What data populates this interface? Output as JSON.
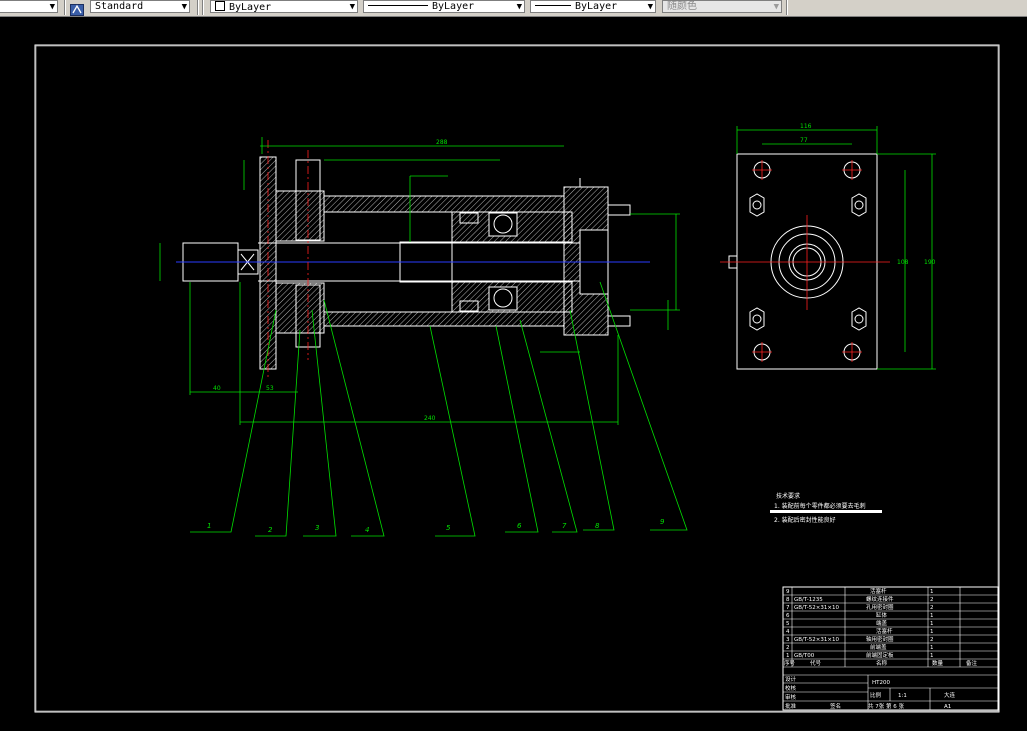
{
  "toolbar": {
    "first_combo_arrow": "▼",
    "text_style": "Standard",
    "layer": "ByLayer",
    "linetype": "ByLayer",
    "lineweight": "ByLayer",
    "plot_style": "随颜色"
  },
  "drawing": {
    "balloons": [
      "1",
      "2",
      "3",
      "4",
      "5",
      "6",
      "7",
      "8",
      "9"
    ],
    "tech_req_title": "技术要求",
    "tech_req_1": "1. 装配前每个零件都必须要去毛刺",
    "tech_req_2": "2. 装配后密封性能良好",
    "bom_rows": [
      {
        "no": "9",
        "code": "",
        "name": "活塞杆",
        "qty": "1"
      },
      {
        "no": "8",
        "code": "GB/T-1235",
        "name": "螺纹连接件",
        "qty": "2"
      },
      {
        "no": "7",
        "code": "GB/T-52×31×10",
        "name": "孔用密封圈",
        "qty": "2"
      },
      {
        "no": "6",
        "code": "",
        "name": "缸体",
        "qty": "1"
      },
      {
        "no": "5",
        "code": "",
        "name": "端盖",
        "qty": "1"
      },
      {
        "no": "4",
        "code": "",
        "name": "活塞杆",
        "qty": "1"
      },
      {
        "no": "3",
        "code": "GB/T-52×31×10",
        "name": "轴用密封圈",
        "qty": "2"
      },
      {
        "no": "2",
        "code": "",
        "name": "前端盖",
        "qty": "1"
      },
      {
        "no": "1",
        "code": "GB/T00",
        "name": "前端固定板",
        "qty": "1"
      }
    ],
    "bom_header": {
      "no": "序号",
      "code": "代号",
      "name": "名称",
      "qty": "数量",
      "remark": "备注"
    },
    "title_block": {
      "design": "设计",
      "check": "校核",
      "review": "审核",
      "approve": "批准",
      "drawing_no": "HT200",
      "scale_label": "比例",
      "scale": "1:1",
      "material": "大连",
      "sheet_label": "共 7张 第 6 张",
      "size": "A1",
      "sign": "签名"
    },
    "dims": {
      "d1": "40",
      "d2": "53",
      "d3": "288",
      "d4": "240",
      "w1": "116",
      "w2": "77",
      "h1": "108",
      "h2": "190"
    }
  }
}
